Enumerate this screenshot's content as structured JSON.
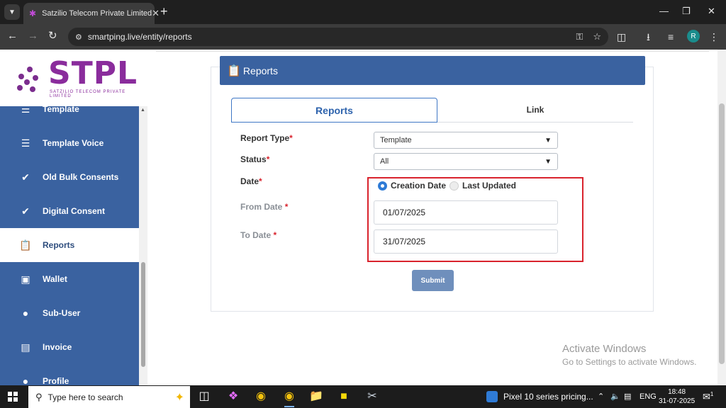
{
  "browser": {
    "tab_title": "Satzilio Telecom Private Limited",
    "url": "smartping.live/entity/reports",
    "profile_initial": "R"
  },
  "logo": {
    "text": "STPL",
    "subtitle": "SATZILIO TELECOM PRIVATE LIMITED"
  },
  "sidebar": {
    "items": [
      {
        "label": "Template",
        "icon": "list-icon"
      },
      {
        "label": "Template Voice",
        "icon": "list-icon"
      },
      {
        "label": "Old Bulk Consents",
        "icon": "check-circle-icon"
      },
      {
        "label": "Digital Consent",
        "icon": "check-circle-icon"
      },
      {
        "label": "Reports",
        "icon": "clipboard-icon",
        "active": true
      },
      {
        "label": "Wallet",
        "icon": "wallet-icon"
      },
      {
        "label": "Sub-User",
        "icon": "user-icon"
      },
      {
        "label": "Invoice",
        "icon": "invoice-icon"
      },
      {
        "label": "Profile",
        "icon": "user-icon"
      }
    ]
  },
  "main": {
    "header_title": "Reports",
    "tabs": [
      {
        "label": "Reports",
        "active": true
      },
      {
        "label": "Link",
        "active": false
      }
    ],
    "form": {
      "report_type_label": "Report Type",
      "report_type_value": "Template",
      "status_label": "Status",
      "status_value": "All",
      "date_label": "Date",
      "radio_creation": "Creation Date",
      "radio_updated": "Last Updated",
      "from_date_label": "From Date",
      "from_date_value": "01/07/2025",
      "to_date_label": "To Date",
      "to_date_value": "31/07/2025",
      "required_mark": "*",
      "submit_label": "Submit"
    }
  },
  "watermark": {
    "line1": "Activate Windows",
    "line2": "Go to Settings to activate Windows."
  },
  "taskbar": {
    "search_placeholder": "Type here to search",
    "news_text": "Pixel 10 series pricing...",
    "language": "ENG",
    "time": "18:48",
    "date": "31-07-2025",
    "notification_count": "1"
  },
  "colors": {
    "primary": "#3a62a0",
    "accent": "#2e63ad",
    "required": "#d9232d",
    "brand": "#8a2c9c"
  }
}
